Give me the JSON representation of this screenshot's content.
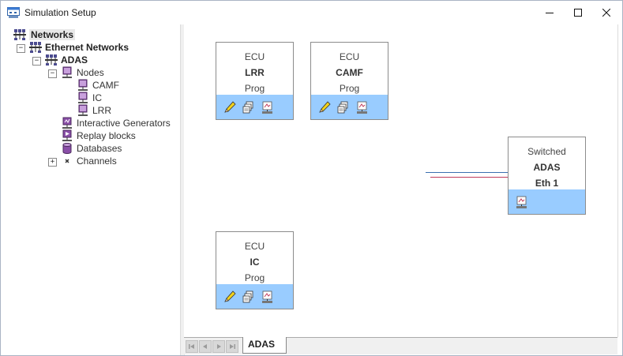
{
  "window": {
    "title": "Simulation Setup",
    "minimize": "—",
    "maximize": "☐",
    "close": "✕"
  },
  "tree": {
    "root": "Networks",
    "ethernet": "Ethernet Networks",
    "adas": "ADAS",
    "nodes": "Nodes",
    "node_items": [
      "CAMF",
      "IC",
      "LRR"
    ],
    "interactive_generators": "Interactive Generators",
    "replay_blocks": "Replay blocks",
    "databases": "Databases",
    "channels": "Channels"
  },
  "cards": {
    "lrr": {
      "type": "ECU",
      "name": "LRR",
      "mode": "Prog"
    },
    "camf": {
      "type": "ECU",
      "name": "CAMF",
      "mode": "Prog"
    },
    "ic": {
      "type": "ECU",
      "name": "IC",
      "mode": "Prog"
    },
    "eth": {
      "type": "Switched",
      "name": "ADAS",
      "channel": "Eth 1"
    }
  },
  "tabs": {
    "active": "ADAS"
  },
  "colors": {
    "toolbar": "#99ccff",
    "bus_blue": "#3a6fb0",
    "bus_red": "#c0395a",
    "icon_purple": "#7a3f9a"
  }
}
